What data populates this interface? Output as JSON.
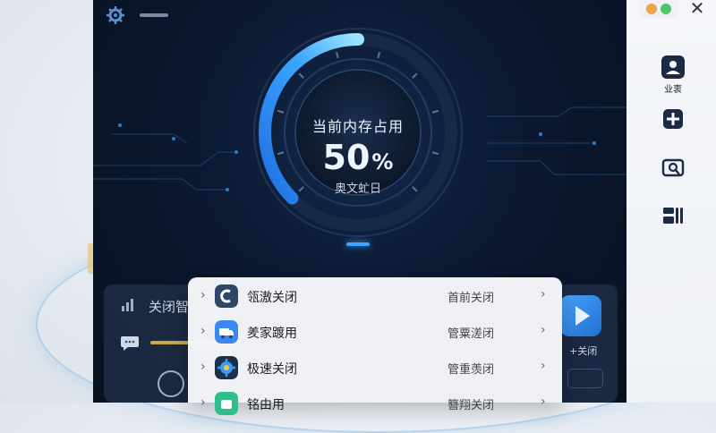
{
  "gauge": {
    "title": "当前内存占用",
    "value": "50",
    "unit": "%",
    "subtitle": "奥文虻日",
    "fraction": 0.5
  },
  "background_panel": {
    "title": "关闭智"
  },
  "right_tile": {
    "label": "+关闭"
  },
  "sidebar": {
    "profile_label": "业衷"
  },
  "menu": {
    "items": [
      {
        "label": "瓴滶关闭",
        "status": "首前关闭",
        "icon": "c-app-icon"
      },
      {
        "label": "羑家踱用",
        "status": "管粟溠闭",
        "icon": "truck-app-icon"
      },
      {
        "label": "极速关闭",
        "status": "管重羡闭",
        "icon": "gear-app-icon"
      },
      {
        "label": "铭由用",
        "status": "簪翔关闭",
        "icon": "green-app-icon"
      }
    ]
  },
  "colors": {
    "accent": "#3aa4ff",
    "window_bg": "#0b1830",
    "menu_bg": "#f7f8fb"
  }
}
